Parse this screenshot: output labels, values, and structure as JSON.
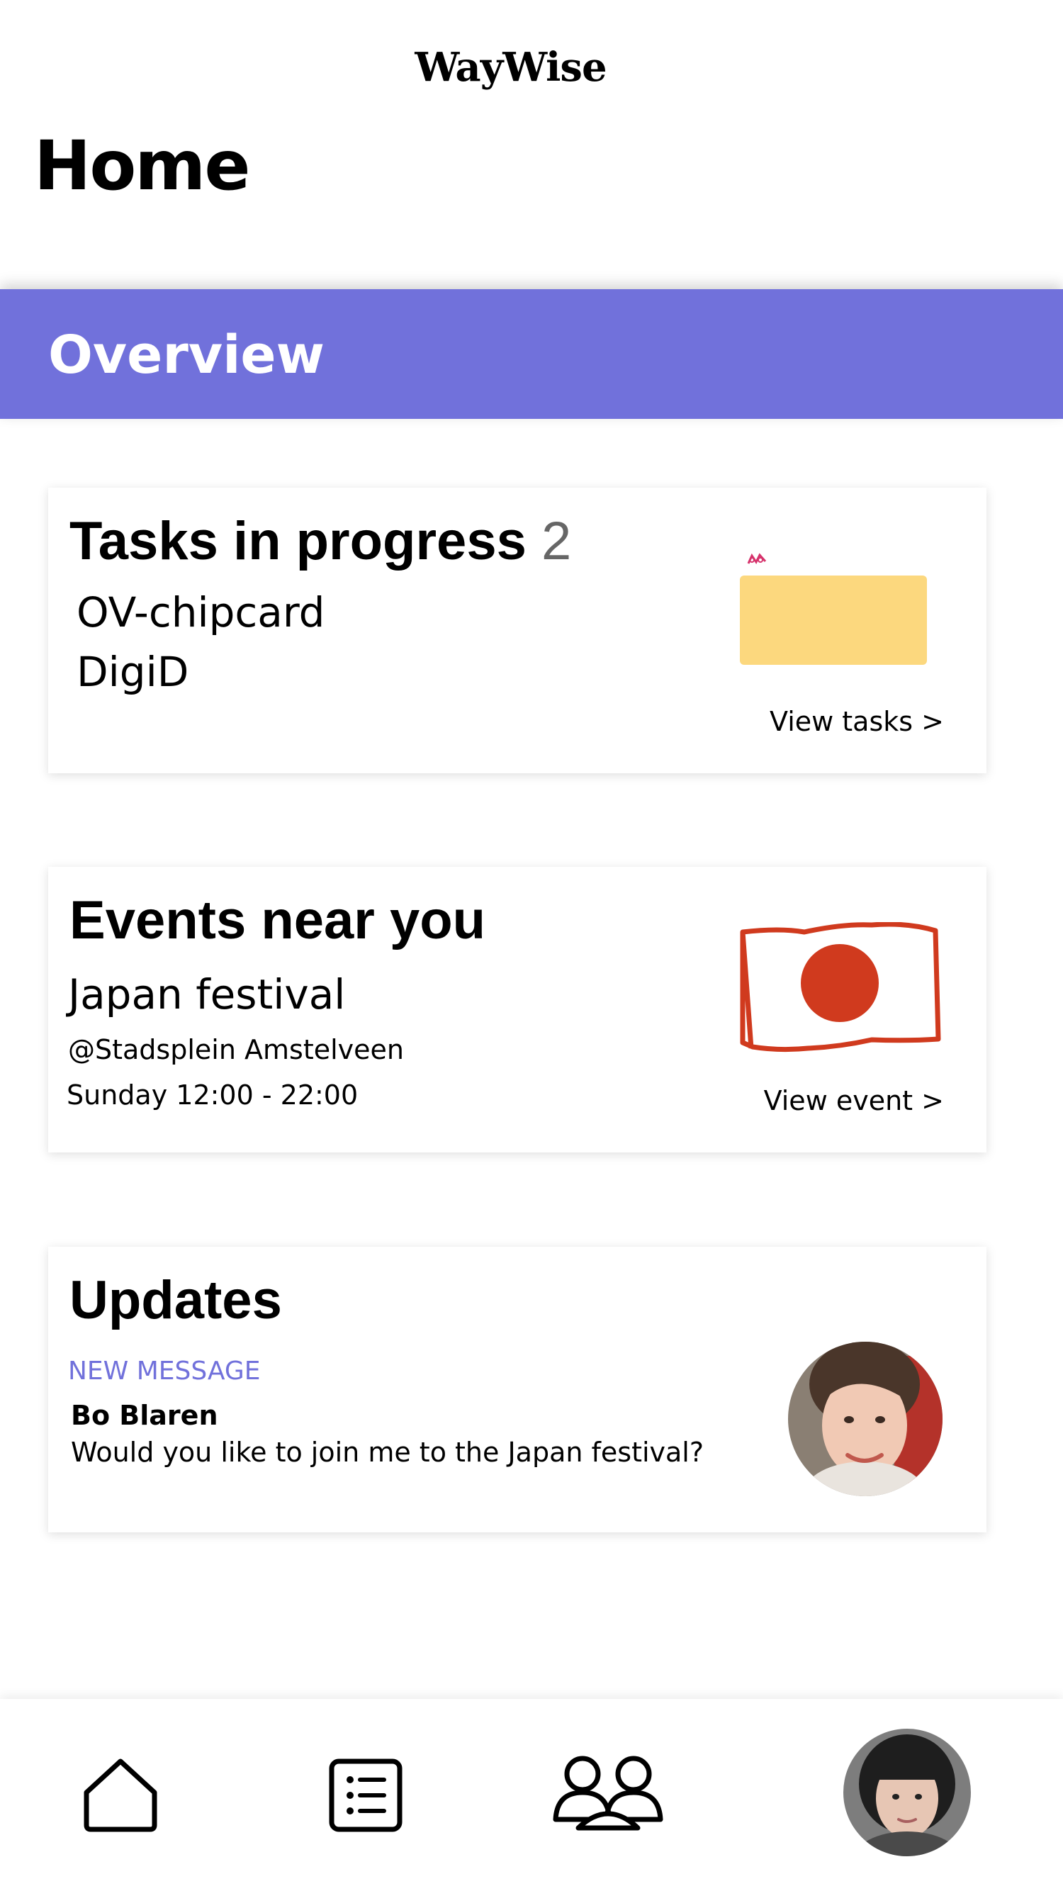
{
  "app": {
    "logo": "WayWise"
  },
  "page": {
    "title": "Home"
  },
  "overview": {
    "title": "Overview",
    "color": "#7171db"
  },
  "tasks": {
    "title": "Tasks in progress",
    "count": "2",
    "items": [
      "OV-chipcard",
      "DigiD"
    ],
    "link": "View tasks >",
    "icon": "folder-icon"
  },
  "events": {
    "title": "Events near you",
    "name": "Japan festival",
    "location": "@Stadsplein Amstelveen",
    "time": "Sunday 12:00 - 22:00",
    "link": "View event >",
    "icon": "japan-flag-icon",
    "flag_color": "#d03a1e"
  },
  "updates": {
    "title": "Updates",
    "label": "NEW MESSAGE",
    "sender": "Bo Blaren",
    "message": "Would you like to join me to the Japan festival?",
    "avatar": "sender-avatar"
  },
  "nav": {
    "items": [
      {
        "icon": "home-icon"
      },
      {
        "icon": "list-icon"
      },
      {
        "icon": "people-icon"
      },
      {
        "icon": "profile-avatar"
      }
    ]
  }
}
